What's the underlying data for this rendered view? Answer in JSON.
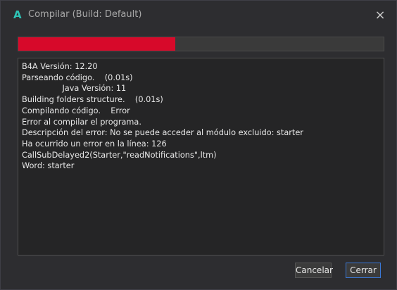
{
  "window": {
    "icon": "A",
    "title": "Compilar (Build: Default)",
    "close_icon": "×"
  },
  "background": {
    "tab_label": "A"
  },
  "progress": {
    "fraction": 0.43,
    "fill_color": "#d7092a"
  },
  "log": {
    "lines": [
      "B4A Versión: 12.20",
      "Parseando código.    (0.01s)",
      "                Java Versión: 11",
      "Building folders structure.    (0.01s)",
      "Compilando código.    Error",
      "Error al compilar el programa.",
      "Descripción del error: No se puede acceder al módulo excluido: starter",
      "Ha ocurrido un error en la línea: 126",
      "CallSubDelayed2(Starter,\"readNotifications\",ltm)",
      "Word: starter"
    ]
  },
  "buttons": {
    "cancel_label": "Cancelar",
    "close_label": "Cerrar"
  }
}
